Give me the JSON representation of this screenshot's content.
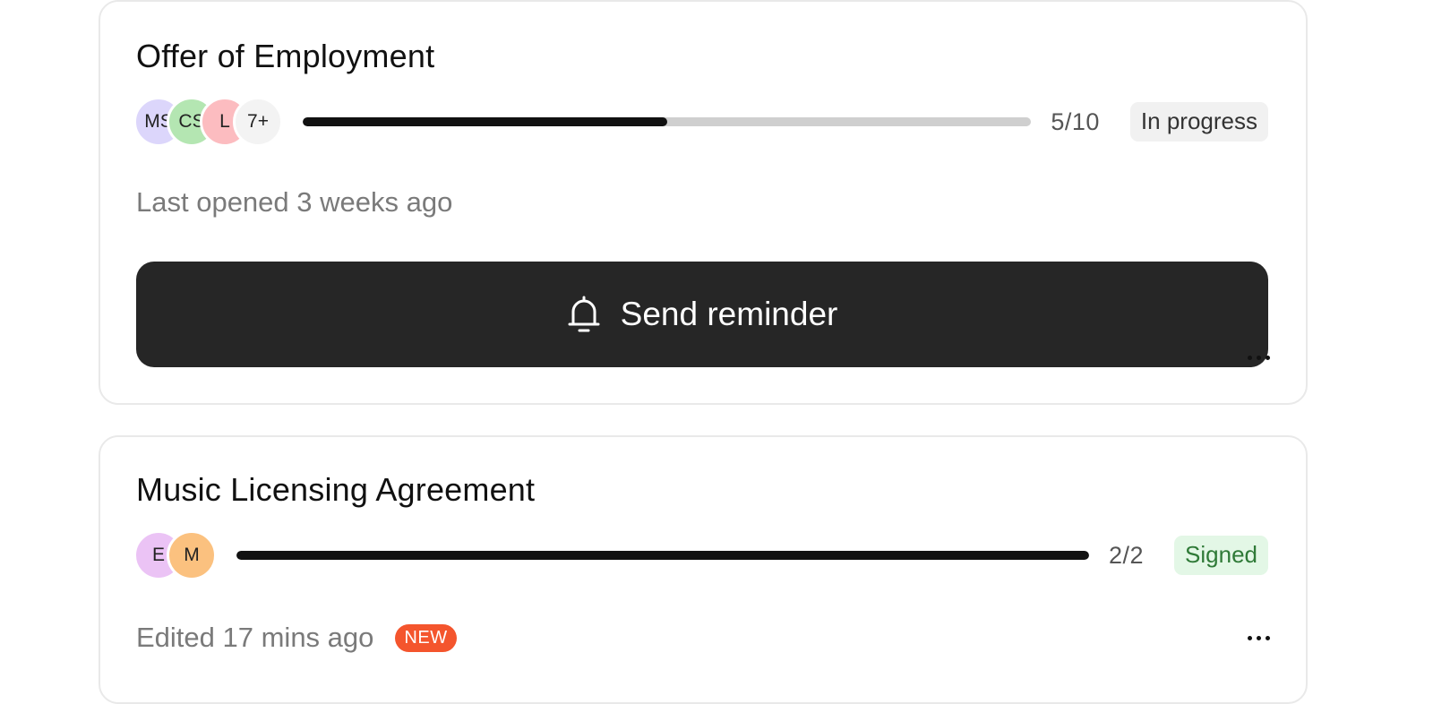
{
  "documents": [
    {
      "title": "Offer of Employment",
      "avatars": [
        {
          "initials": "MS",
          "color": "#dcd6fb"
        },
        {
          "initials": "CS",
          "color": "#b4e6b2"
        },
        {
          "initials": "L",
          "color": "#fcbcc0"
        },
        {
          "initials": "7+",
          "color": "#f3f3f3"
        }
      ],
      "progress": 0.5,
      "count": "5/10",
      "status": "In progress",
      "meta": "Last opened 3 weeks ago",
      "action": {
        "label": "Send reminder",
        "icon": "bell-icon"
      },
      "more_icon": "more-horizontal-icon"
    },
    {
      "title": "Music Licensing Agreement",
      "avatars": [
        {
          "initials": "E",
          "color": "#ebc3f5"
        },
        {
          "initials": "M",
          "color": "#fbc17f"
        }
      ],
      "progress": 1.0,
      "count": "2/2",
      "status": "Signed",
      "meta": "Edited 17 mins ago",
      "new_badge": "NEW",
      "more_icon": "more-horizontal-icon"
    }
  ]
}
